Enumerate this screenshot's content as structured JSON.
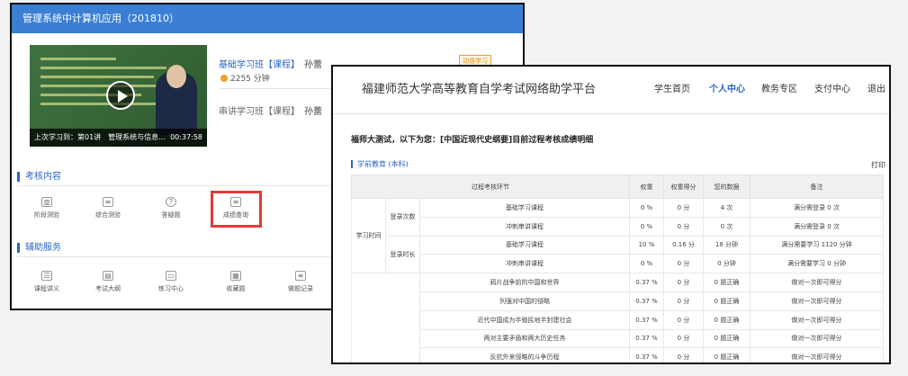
{
  "left_window": {
    "title": "管理系统中计算机应用（201810）",
    "video": {
      "last_study": "上次学习到：第01讲　管理系统与信息...",
      "duration": "00:37:58"
    },
    "courses": [
      {
        "name": "基础学习班【课程】",
        "teacher": "孙蕾",
        "duration": "2255 分钟",
        "badge": "动感学习"
      },
      {
        "name": "串讲学习班【课程】",
        "teacher": "孙蕾"
      }
    ],
    "exam_section": {
      "heading": "考核内容",
      "tiles": [
        "阶段测验",
        "综合测验",
        "答疑题",
        "成绩查询"
      ]
    },
    "aux_section": {
      "heading": "辅助服务",
      "tiles": [
        "课程讲义",
        "考试大纲",
        "练习中心",
        "收藏题",
        "做题记录"
      ]
    }
  },
  "right_window": {
    "site_title": "福建师范大学高等教育自学考试网络助学平台",
    "nav": [
      "学生首页",
      "个人中心",
      "教务专区",
      "支付中心",
      "退出"
    ],
    "active_nav": "个人中心",
    "report_title": "福师大测试，以下为您：[中国近现代史纲要]目前过程考核成绩明细",
    "subtitle": "学前教育 (本科)",
    "print_label": "打印",
    "table": {
      "headers": [
        "过程考核环节",
        "权重",
        "权重得分",
        "您的数据",
        "备注"
      ],
      "group_label": "学习时间",
      "subgroups": [
        "登录次数",
        "登录时长"
      ],
      "rows": [
        [
          "基础学习课程",
          "0 %",
          "0 分",
          "4 次",
          "满分需登录 0 次"
        ],
        [
          "冲刺串讲课程",
          "0 %",
          "0 分",
          "0 次",
          "满分需登录 0 次"
        ],
        [
          "基础学习课程",
          "10 %",
          "0.16 分",
          "18 分钟",
          "满分需要学习 1120 分钟"
        ],
        [
          "冲刺串讲课程",
          "0 %",
          "0 分",
          "0 分钟",
          "满分需要学习 0 分钟"
        ],
        [
          "鸦片战争前的中国和世界",
          "0.37 %",
          "0 分",
          "0 题正确",
          "做对一次即可得分"
        ],
        [
          "列强对中国的侵略",
          "0.37 %",
          "0 分",
          "0 题正确",
          "做对一次即可得分"
        ],
        [
          "近代中国成为半殖民地半封建社会",
          "0.37 %",
          "0 分",
          "0 题正确",
          "做对一次即可得分"
        ],
        [
          "两对主要矛盾和两大历史任务",
          "0.37 %",
          "0 分",
          "0 题正确",
          "做对一次即可得分"
        ],
        [
          "反抗外来侵略的斗争历程",
          "0.37 %",
          "0 分",
          "0 题正确",
          "做对一次即可得分"
        ]
      ]
    }
  }
}
